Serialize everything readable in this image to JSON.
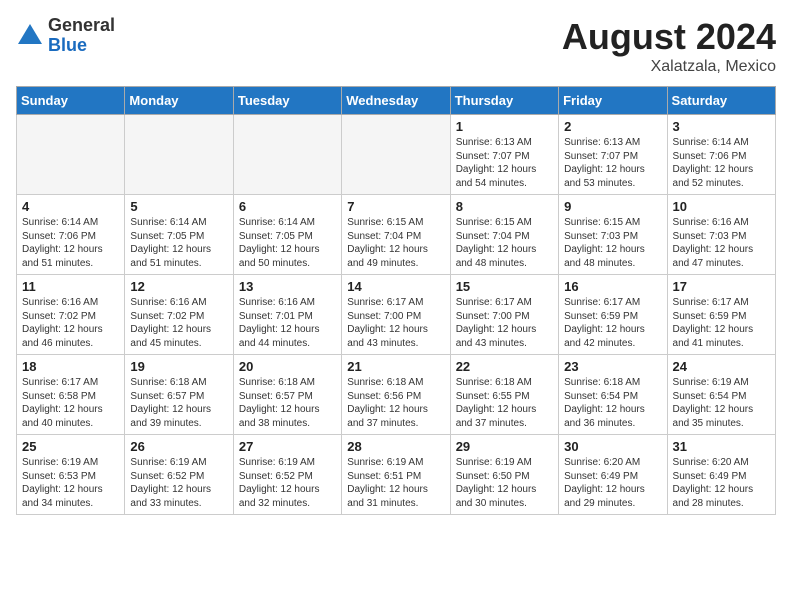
{
  "logo": {
    "general": "General",
    "blue": "Blue"
  },
  "title": "August 2024",
  "location": "Xalatzala, Mexico",
  "headers": [
    "Sunday",
    "Monday",
    "Tuesday",
    "Wednesday",
    "Thursday",
    "Friday",
    "Saturday"
  ],
  "weeks": [
    [
      {
        "day": "",
        "info": ""
      },
      {
        "day": "",
        "info": ""
      },
      {
        "day": "",
        "info": ""
      },
      {
        "day": "",
        "info": ""
      },
      {
        "day": "1",
        "info": "Sunrise: 6:13 AM\nSunset: 7:07 PM\nDaylight: 12 hours\nand 54 minutes."
      },
      {
        "day": "2",
        "info": "Sunrise: 6:13 AM\nSunset: 7:07 PM\nDaylight: 12 hours\nand 53 minutes."
      },
      {
        "day": "3",
        "info": "Sunrise: 6:14 AM\nSunset: 7:06 PM\nDaylight: 12 hours\nand 52 minutes."
      }
    ],
    [
      {
        "day": "4",
        "info": "Sunrise: 6:14 AM\nSunset: 7:06 PM\nDaylight: 12 hours\nand 51 minutes."
      },
      {
        "day": "5",
        "info": "Sunrise: 6:14 AM\nSunset: 7:05 PM\nDaylight: 12 hours\nand 51 minutes."
      },
      {
        "day": "6",
        "info": "Sunrise: 6:14 AM\nSunset: 7:05 PM\nDaylight: 12 hours\nand 50 minutes."
      },
      {
        "day": "7",
        "info": "Sunrise: 6:15 AM\nSunset: 7:04 PM\nDaylight: 12 hours\nand 49 minutes."
      },
      {
        "day": "8",
        "info": "Sunrise: 6:15 AM\nSunset: 7:04 PM\nDaylight: 12 hours\nand 48 minutes."
      },
      {
        "day": "9",
        "info": "Sunrise: 6:15 AM\nSunset: 7:03 PM\nDaylight: 12 hours\nand 48 minutes."
      },
      {
        "day": "10",
        "info": "Sunrise: 6:16 AM\nSunset: 7:03 PM\nDaylight: 12 hours\nand 47 minutes."
      }
    ],
    [
      {
        "day": "11",
        "info": "Sunrise: 6:16 AM\nSunset: 7:02 PM\nDaylight: 12 hours\nand 46 minutes."
      },
      {
        "day": "12",
        "info": "Sunrise: 6:16 AM\nSunset: 7:02 PM\nDaylight: 12 hours\nand 45 minutes."
      },
      {
        "day": "13",
        "info": "Sunrise: 6:16 AM\nSunset: 7:01 PM\nDaylight: 12 hours\nand 44 minutes."
      },
      {
        "day": "14",
        "info": "Sunrise: 6:17 AM\nSunset: 7:00 PM\nDaylight: 12 hours\nand 43 minutes."
      },
      {
        "day": "15",
        "info": "Sunrise: 6:17 AM\nSunset: 7:00 PM\nDaylight: 12 hours\nand 43 minutes."
      },
      {
        "day": "16",
        "info": "Sunrise: 6:17 AM\nSunset: 6:59 PM\nDaylight: 12 hours\nand 42 minutes."
      },
      {
        "day": "17",
        "info": "Sunrise: 6:17 AM\nSunset: 6:59 PM\nDaylight: 12 hours\nand 41 minutes."
      }
    ],
    [
      {
        "day": "18",
        "info": "Sunrise: 6:17 AM\nSunset: 6:58 PM\nDaylight: 12 hours\nand 40 minutes."
      },
      {
        "day": "19",
        "info": "Sunrise: 6:18 AM\nSunset: 6:57 PM\nDaylight: 12 hours\nand 39 minutes."
      },
      {
        "day": "20",
        "info": "Sunrise: 6:18 AM\nSunset: 6:57 PM\nDaylight: 12 hours\nand 38 minutes."
      },
      {
        "day": "21",
        "info": "Sunrise: 6:18 AM\nSunset: 6:56 PM\nDaylight: 12 hours\nand 37 minutes."
      },
      {
        "day": "22",
        "info": "Sunrise: 6:18 AM\nSunset: 6:55 PM\nDaylight: 12 hours\nand 37 minutes."
      },
      {
        "day": "23",
        "info": "Sunrise: 6:18 AM\nSunset: 6:54 PM\nDaylight: 12 hours\nand 36 minutes."
      },
      {
        "day": "24",
        "info": "Sunrise: 6:19 AM\nSunset: 6:54 PM\nDaylight: 12 hours\nand 35 minutes."
      }
    ],
    [
      {
        "day": "25",
        "info": "Sunrise: 6:19 AM\nSunset: 6:53 PM\nDaylight: 12 hours\nand 34 minutes."
      },
      {
        "day": "26",
        "info": "Sunrise: 6:19 AM\nSunset: 6:52 PM\nDaylight: 12 hours\nand 33 minutes."
      },
      {
        "day": "27",
        "info": "Sunrise: 6:19 AM\nSunset: 6:52 PM\nDaylight: 12 hours\nand 32 minutes."
      },
      {
        "day": "28",
        "info": "Sunrise: 6:19 AM\nSunset: 6:51 PM\nDaylight: 12 hours\nand 31 minutes."
      },
      {
        "day": "29",
        "info": "Sunrise: 6:19 AM\nSunset: 6:50 PM\nDaylight: 12 hours\nand 30 minutes."
      },
      {
        "day": "30",
        "info": "Sunrise: 6:20 AM\nSunset: 6:49 PM\nDaylight: 12 hours\nand 29 minutes."
      },
      {
        "day": "31",
        "info": "Sunrise: 6:20 AM\nSunset: 6:49 PM\nDaylight: 12 hours\nand 28 minutes."
      }
    ]
  ]
}
